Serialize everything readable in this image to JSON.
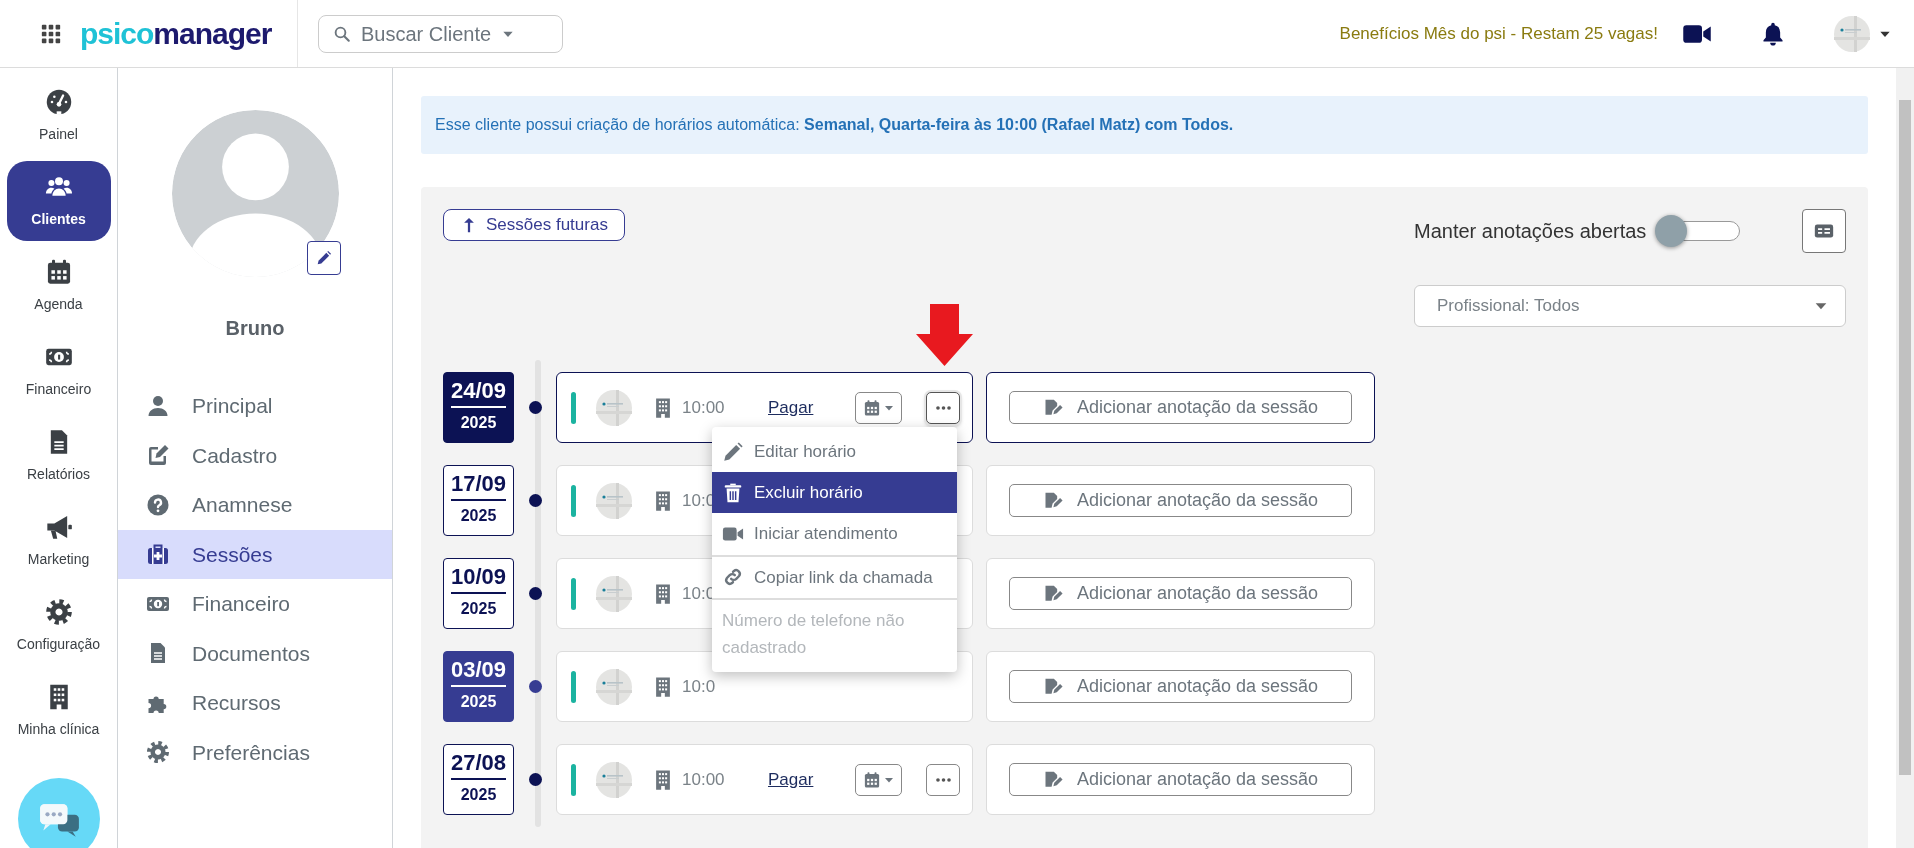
{
  "topbar": {
    "logo": {
      "first": "psico",
      "second": "manager"
    },
    "search": {
      "label": "Buscar Cliente"
    },
    "promo": "Benefícios Mês do psi - Restam 25 vagas!"
  },
  "rail": {
    "items": [
      {
        "label": "Painel",
        "selected": false
      },
      {
        "label": "Clientes",
        "selected": true
      },
      {
        "label": "Agenda",
        "selected": false
      },
      {
        "label": "Financeiro",
        "selected": false
      },
      {
        "label": "Relatórios",
        "selected": false
      },
      {
        "label": "Marketing",
        "selected": false
      },
      {
        "label": "Configuração",
        "selected": false
      },
      {
        "label": "Minha clínica",
        "selected": false
      }
    ]
  },
  "client": {
    "name": "Bruno",
    "menu": [
      {
        "label": "Principal",
        "selected": false
      },
      {
        "label": "Cadastro",
        "selected": false
      },
      {
        "label": "Anamnese",
        "selected": false
      },
      {
        "label": "Sessões",
        "selected": true
      },
      {
        "label": "Financeiro",
        "selected": false
      },
      {
        "label": "Documentos",
        "selected": false
      },
      {
        "label": "Recursos",
        "selected": false
      },
      {
        "label": "Preferências",
        "selected": false
      }
    ]
  },
  "alert": {
    "text": "Esse cliente possui criação de horários automática: **Semanal, Quarta-feira às 10:00 (Rafael Matz) com Todos.**"
  },
  "sessions_panel": {
    "future_button": "Sessões futuras",
    "keep_notes": {
      "label": "Manter anotações abertas",
      "on": false
    },
    "professional_select": {
      "value": "Profissional: Todos"
    },
    "sessions": [
      {
        "day": "24/09",
        "year": "2025",
        "kind": "current",
        "selected": true,
        "time": "10:00",
        "pay": "Pagar",
        "menu_open": true,
        "note_button": "Adicionar anotação da sessão"
      },
      {
        "day": "17/09",
        "year": "2025",
        "kind": "plain",
        "selected": false,
        "time": "10:0",
        "menu_open": false,
        "note_button": "Adicionar anotação da sessão"
      },
      {
        "day": "10/09",
        "year": "2025",
        "kind": "plain",
        "selected": false,
        "time": "10:0",
        "menu_open": false,
        "note_button": "Adicionar anotação da sessão"
      },
      {
        "day": "03/09",
        "year": "2025",
        "kind": "marked",
        "selected": false,
        "time": "10:0",
        "menu_open": false,
        "note_button": "Adicionar anotação da sessão"
      },
      {
        "day": "27/08",
        "year": "2025",
        "kind": "plain",
        "selected": false,
        "time": "10:00",
        "pay": "Pagar",
        "menu_open": false,
        "note_button": "Adicionar anotação da sessão"
      }
    ],
    "session_menu": {
      "items": [
        {
          "label": "Editar horário",
          "selected": false,
          "disabled": false,
          "divider_before": false
        },
        {
          "label": "Excluir horário",
          "selected": true,
          "disabled": false,
          "divider_before": false
        },
        {
          "label": "Iniciar atendimento",
          "selected": false,
          "disabled": false,
          "divider_before": false
        },
        {
          "label": "Copiar link da chamada",
          "selected": false,
          "disabled": false,
          "divider_before": true
        },
        {
          "label": "Número de telefone não cadastrado",
          "selected": false,
          "disabled": true,
          "divider_before": true
        }
      ]
    }
  }
}
